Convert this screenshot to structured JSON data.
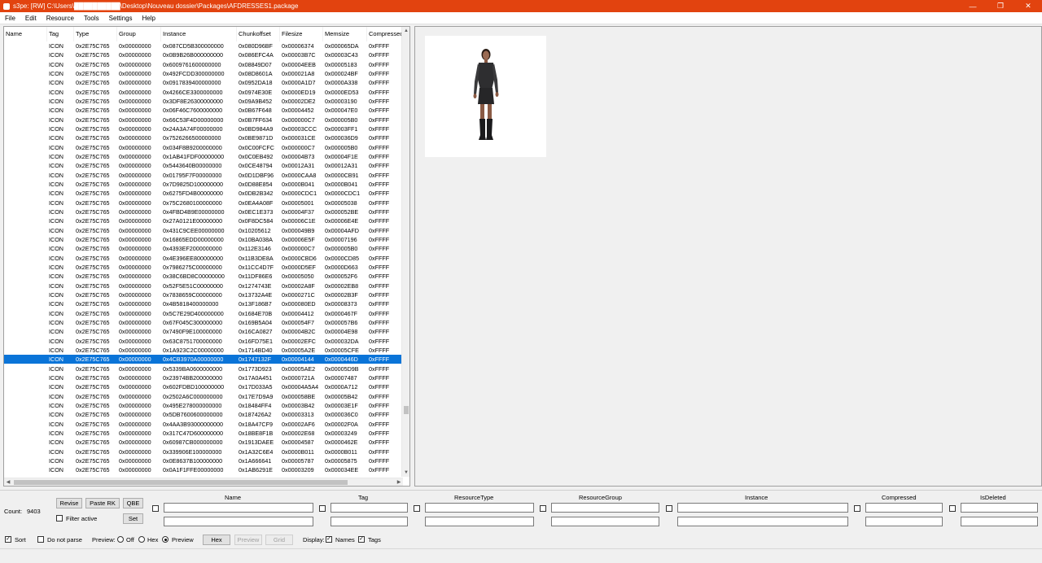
{
  "window": {
    "title": "s3pe: [RW] C:\\Users\\██████████\\Desktop\\Nouveau dossier\\Packages\\AFDRESSES1.package",
    "minimize": "—",
    "maximize": "❐",
    "close": "✕"
  },
  "menu": [
    "File",
    "Edit",
    "Resource",
    "Tools",
    "Settings",
    "Help"
  ],
  "columns": [
    "Name",
    "Tag",
    "Type",
    "Group",
    "Instance",
    "Chunkoffset",
    "Filesize",
    "Memsize",
    "Compressed"
  ],
  "rows": [
    [
      "",
      "ICON",
      "0x2E75C765",
      "0x00000000",
      "0x087CD5B300000000",
      "0x080D96BF",
      "0x00006374",
      "0x000065DA",
      "0xFFFF"
    ],
    [
      "",
      "ICON",
      "0x2E75C765",
      "0x00000000",
      "0x0B9B26B000000000",
      "0x086EFC4A",
      "0x00003B7C",
      "0x00003C43",
      "0xFFFF"
    ],
    [
      "",
      "ICON",
      "0x2E75C765",
      "0x00000000",
      "0x6009761600000000",
      "0x08849D07",
      "0x00004EEB",
      "0x00005183",
      "0xFFFF"
    ],
    [
      "",
      "ICON",
      "0x2E75C765",
      "0x00000000",
      "0x492FCDD300000000",
      "0x08D8601A",
      "0x000021A8",
      "0x000024BF",
      "0xFFFF"
    ],
    [
      "",
      "ICON",
      "0x2E75C765",
      "0x00000000",
      "0x0917839400000000",
      "0x0952DA18",
      "0x0000A1D7",
      "0x0000A338",
      "0xFFFF"
    ],
    [
      "",
      "ICON",
      "0x2E75C765",
      "0x00000000",
      "0x4266CE3300000000",
      "0x0974E30E",
      "0x0000ED19",
      "0x0000ED53",
      "0xFFFF"
    ],
    [
      "",
      "ICON",
      "0x2E75C765",
      "0x00000000",
      "0x3DF8E26300000000",
      "0x09A9B452",
      "0x00002DE2",
      "0x00003190",
      "0xFFFF"
    ],
    [
      "",
      "ICON",
      "0x2E75C765",
      "0x00000000",
      "0x06F46C7600000000",
      "0x0B67F648",
      "0x00004452",
      "0x000047E0",
      "0xFFFF"
    ],
    [
      "",
      "ICON",
      "0x2E75C765",
      "0x00000000",
      "0x66C53F4D00000000",
      "0x0B7FF634",
      "0x000000C7",
      "0x000005B0",
      "0xFFFF"
    ],
    [
      "",
      "ICON",
      "0x2E75C765",
      "0x00000000",
      "0x24A3A74F00000000",
      "0x0BD984A9",
      "0x00003CCC",
      "0x00003FF1",
      "0xFFFF"
    ],
    [
      "",
      "ICON",
      "0x2E75C765",
      "0x00000000",
      "0x7526266500000000",
      "0x0BE9871D",
      "0x000031CE",
      "0x000036D9",
      "0xFFFF"
    ],
    [
      "",
      "ICON",
      "0x2E75C765",
      "0x00000000",
      "0x034F8B9200000000",
      "0x0C00FCFC",
      "0x000000C7",
      "0x000005B0",
      "0xFFFF"
    ],
    [
      "",
      "ICON",
      "0x2E75C765",
      "0x00000000",
      "0x1AB41FDF00000000",
      "0x0C0EB492",
      "0x00004B73",
      "0x00004F1E",
      "0xFFFF"
    ],
    [
      "",
      "ICON",
      "0x2E75C765",
      "0x00000000",
      "0x5443640B00000000",
      "0x0CE48794",
      "0x00012A31",
      "0x00012A31",
      "0xFFFF"
    ],
    [
      "",
      "ICON",
      "0x2E75C765",
      "0x00000000",
      "0x01795F7F00000000",
      "0x0D1DBF96",
      "0x0000CAA8",
      "0x0000CB91",
      "0xFFFF"
    ],
    [
      "",
      "ICON",
      "0x2E75C765",
      "0x00000000",
      "0x7D9825D100000000",
      "0x0D88E854",
      "0x0000B041",
      "0x0000B041",
      "0xFFFF"
    ],
    [
      "",
      "ICON",
      "0x2E75C765",
      "0x00000000",
      "0x6275FD4B00000000",
      "0x0DB2B342",
      "0x0000CDC1",
      "0x0000CDC1",
      "0xFFFF"
    ],
    [
      "",
      "ICON",
      "0x2E75C765",
      "0x00000000",
      "0x75C2680100000000",
      "0x0EA4A08F",
      "0x00005001",
      "0x00005038",
      "0xFFFF"
    ],
    [
      "",
      "ICON",
      "0x2E75C765",
      "0x00000000",
      "0x4FBD4B9E00000000",
      "0x0EC1E373",
      "0x00004F37",
      "0x000052BE",
      "0xFFFF"
    ],
    [
      "",
      "ICON",
      "0x2E75C765",
      "0x00000000",
      "0x27A0121E00000000",
      "0x0F8DC584",
      "0x00006C1E",
      "0x00006E4E",
      "0xFFFF"
    ],
    [
      "",
      "ICON",
      "0x2E75C765",
      "0x00000000",
      "0x431C9CEE00000000",
      "0x10205612",
      "0x000049B9",
      "0x00004AFD",
      "0xFFFF"
    ],
    [
      "",
      "ICON",
      "0x2E75C765",
      "0x00000000",
      "0x16865EDD00000000",
      "0x10BA038A",
      "0x00006E5F",
      "0x00007196",
      "0xFFFF"
    ],
    [
      "",
      "ICON",
      "0x2E75C765",
      "0x00000000",
      "0x4393EF2000000000",
      "0x112E3146",
      "0x000000C7",
      "0x000005B0",
      "0xFFFF"
    ],
    [
      "",
      "ICON",
      "0x2E75C765",
      "0x00000000",
      "0x4E396EE800000000",
      "0x11B3DE8A",
      "0x0000CBD6",
      "0x0000CD85",
      "0xFFFF"
    ],
    [
      "",
      "ICON",
      "0x2E75C765",
      "0x00000000",
      "0x7986275C00000000",
      "0x11CC4D7F",
      "0x0000D5EF",
      "0x0000D663",
      "0xFFFF"
    ],
    [
      "",
      "ICON",
      "0x2E75C765",
      "0x00000000",
      "0x38C6BD8C00000000",
      "0x11DF86E6",
      "0x00005050",
      "0x000052F6",
      "0xFFFF"
    ],
    [
      "",
      "ICON",
      "0x2E75C765",
      "0x00000000",
      "0x52F5E51C00000000",
      "0x1274743E",
      "0x00002A8F",
      "0x00002EB8",
      "0xFFFF"
    ],
    [
      "",
      "ICON",
      "0x2E75C765",
      "0x00000000",
      "0x7838659C00000000",
      "0x13732A4E",
      "0x0000271C",
      "0x00002B3F",
      "0xFFFF"
    ],
    [
      "",
      "ICON",
      "0x2E75C765",
      "0x00000000",
      "0x4B5818400000000",
      "0x13F186B7",
      "0x000080ED",
      "0x00008373",
      "0xFFFF"
    ],
    [
      "",
      "ICON",
      "0x2E75C765",
      "0x00000000",
      "0x5C7E29D400000000",
      "0x1684E70B",
      "0x00004412",
      "0x0000467F",
      "0xFFFF"
    ],
    [
      "",
      "ICON",
      "0x2E75C765",
      "0x00000000",
      "0x67F045C300000000",
      "0x169B5A04",
      "0x000054F7",
      "0x000057B6",
      "0xFFFF"
    ],
    [
      "",
      "ICON",
      "0x2E75C765",
      "0x00000000",
      "0x7490F9E100000000",
      "0x16CA0827",
      "0x00004B2C",
      "0x00004E98",
      "0xFFFF"
    ],
    [
      "",
      "ICON",
      "0x2E75C765",
      "0x00000000",
      "0x63C8751700000000",
      "0x16FD75E1",
      "0x00002EFC",
      "0x000032DA",
      "0xFFFF"
    ],
    [
      "",
      "ICON",
      "0x2E75C765",
      "0x00000000",
      "0x1A923C2C00000000",
      "0x1714BD40",
      "0x00005A2E",
      "0x00005CFE",
      "0xFFFF"
    ],
    [
      "",
      "ICON",
      "0x2E75C765",
      "0x00000000",
      "0x4CB3970A00000000",
      "0x1747132F",
      "0x00004144",
      "0x0000446D",
      "0xFFFF"
    ],
    [
      "",
      "ICON",
      "0x2E75C765",
      "0x00000000",
      "0x5339BA0600000000",
      "0x1773D923",
      "0x00005AE2",
      "0x00005D9B",
      "0xFFFF"
    ],
    [
      "",
      "ICON",
      "0x2E75C765",
      "0x00000000",
      "0x23974BB200000000",
      "0x17A0A451",
      "0x0000721A",
      "0x00007487",
      "0xFFFF"
    ],
    [
      "",
      "ICON",
      "0x2E75C765",
      "0x00000000",
      "0x602FDBD100000000",
      "0x17D033A5",
      "0x00004A5A4",
      "0x0000A712",
      "0xFFFF"
    ],
    [
      "",
      "ICON",
      "0x2E75C765",
      "0x00000000",
      "0x2502A6C000000000",
      "0x17E7D9A9",
      "0x000058BE",
      "0x00005B42",
      "0xFFFF"
    ],
    [
      "",
      "ICON",
      "0x2E75C765",
      "0x00000000",
      "0x495E278000000000",
      "0x18484FF4",
      "0x00003B42",
      "0x00003E1F",
      "0xFFFF"
    ],
    [
      "",
      "ICON",
      "0x2E75C765",
      "0x00000000",
      "0x5DB7600600000000",
      "0x187426A2",
      "0x00003313",
      "0x000036C0",
      "0xFFFF"
    ],
    [
      "",
      "ICON",
      "0x2E75C765",
      "0x00000000",
      "0x4AA3B93000000000",
      "0x18A47CF9",
      "0x00002AF6",
      "0x00002F0A",
      "0xFFFF"
    ],
    [
      "",
      "ICON",
      "0x2E75C765",
      "0x00000000",
      "0x317C47D600000000",
      "0x18BE8F1B",
      "0x00002E68",
      "0x00003249",
      "0xFFFF"
    ],
    [
      "",
      "ICON",
      "0x2E75C765",
      "0x00000000",
      "0x60987CB000000000",
      "0x1913DAEE",
      "0x00004587",
      "0x0000462E",
      "0xFFFF"
    ],
    [
      "",
      "ICON",
      "0x2E75C765",
      "0x00000000",
      "0x339906E100000000",
      "0x1A32C6E4",
      "0x0000B011",
      "0x0000B011",
      "0xFFFF"
    ],
    [
      "",
      "ICON",
      "0x2E75C765",
      "0x00000000",
      "0x0E8637B100000000",
      "0x1A666641",
      "0x00005787",
      "0x00005875",
      "0xFFFF"
    ],
    [
      "",
      "ICON",
      "0x2E75C765",
      "0x00000000",
      "0x0A1F1FFE00000000",
      "0x1AB6291E",
      "0x00003209",
      "0x000034EE",
      "0xFFFF"
    ]
  ],
  "selected_row": 34,
  "bottom": {
    "count_label": "Count:",
    "count_value": "9403",
    "revise": "Revise",
    "paste_rk": "Paste RK",
    "qbe": "QBE",
    "filter_active": "Filter active",
    "set": "Set",
    "filter_headers": [
      "Name",
      "Tag",
      "ResourceType",
      "ResourceGroup",
      "Instance",
      "Compressed",
      "IsDeleted"
    ],
    "sort": "Sort",
    "do_not_parse": "Do not parse",
    "preview_label": "Preview:",
    "off": "Off",
    "hex": "Hex",
    "preview_opt": "Preview",
    "hex_btn": "Hex",
    "preview_btn": "Preview",
    "grid_btn": "Grid",
    "display_label": "Display:",
    "names": "Names",
    "tags": "Tags"
  },
  "colors": {
    "titlebar": "#e2430f",
    "selection": "#0a74d8"
  }
}
